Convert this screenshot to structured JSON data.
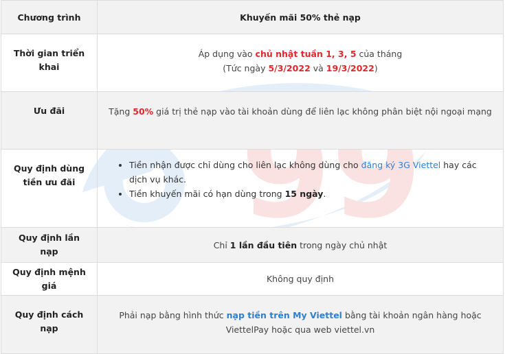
{
  "table": {
    "header": {
      "col1": "Chương trình",
      "col2": "Khuyến mãi 50% thẻ nạp"
    },
    "rows": {
      "r1": {
        "label": "Thời gian triển khai",
        "line1_a": "Áp dụng vào ",
        "line1_b": "chủ nhật tuần 1, 3, 5",
        "line1_c": " của tháng",
        "line2_a": "(Tức ngày ",
        "line2_b": "5/3/2022",
        "line2_c": " và ",
        "line2_d": "19/3/2022",
        "line2_e": ")"
      },
      "r2": {
        "label": "Ưu đãi",
        "a": "Tặng ",
        "b": "50%",
        "c": " giá trị thẻ nạp vào tài khoản dùng để liên lạc không phân biệt nội ngoại mạng"
      },
      "r3": {
        "label": "Quy định dùng tiền ưu đãi",
        "item1_a": "Tiền nhận được chỉ dùng cho liên lạc không dùng cho ",
        "item1_link": "đăng ký 3G Viettel",
        "item1_b": " hay các dịch vụ khác.",
        "item2_a": "Tiền khuyến mãi có hạn dùng trong ",
        "item2_b": "15 ngày",
        "item2_c": "."
      },
      "r4": {
        "label": "Quy định lần nạp",
        "a": "Chỉ ",
        "b": "1 lần đầu tiên",
        "c": " trong ngày chủ nhật"
      },
      "r5": {
        "label": "Quy định mệnh giá",
        "value": "Không quy định"
      },
      "r6": {
        "label": "Quy định cách nạp",
        "a": "Phải nạp bằng hình thức ",
        "b": "nạp tiền trên My Viettel",
        "c": " bằng tài khoản ngân hàng hoặc ViettelPay hoặc qua web viettel.vn"
      }
    }
  },
  "watermark": {
    "text": "99"
  },
  "colors": {
    "highlight_red": "#e3262b",
    "link_blue": "#2f7fd1",
    "header_bg": "#f2f2f2"
  }
}
